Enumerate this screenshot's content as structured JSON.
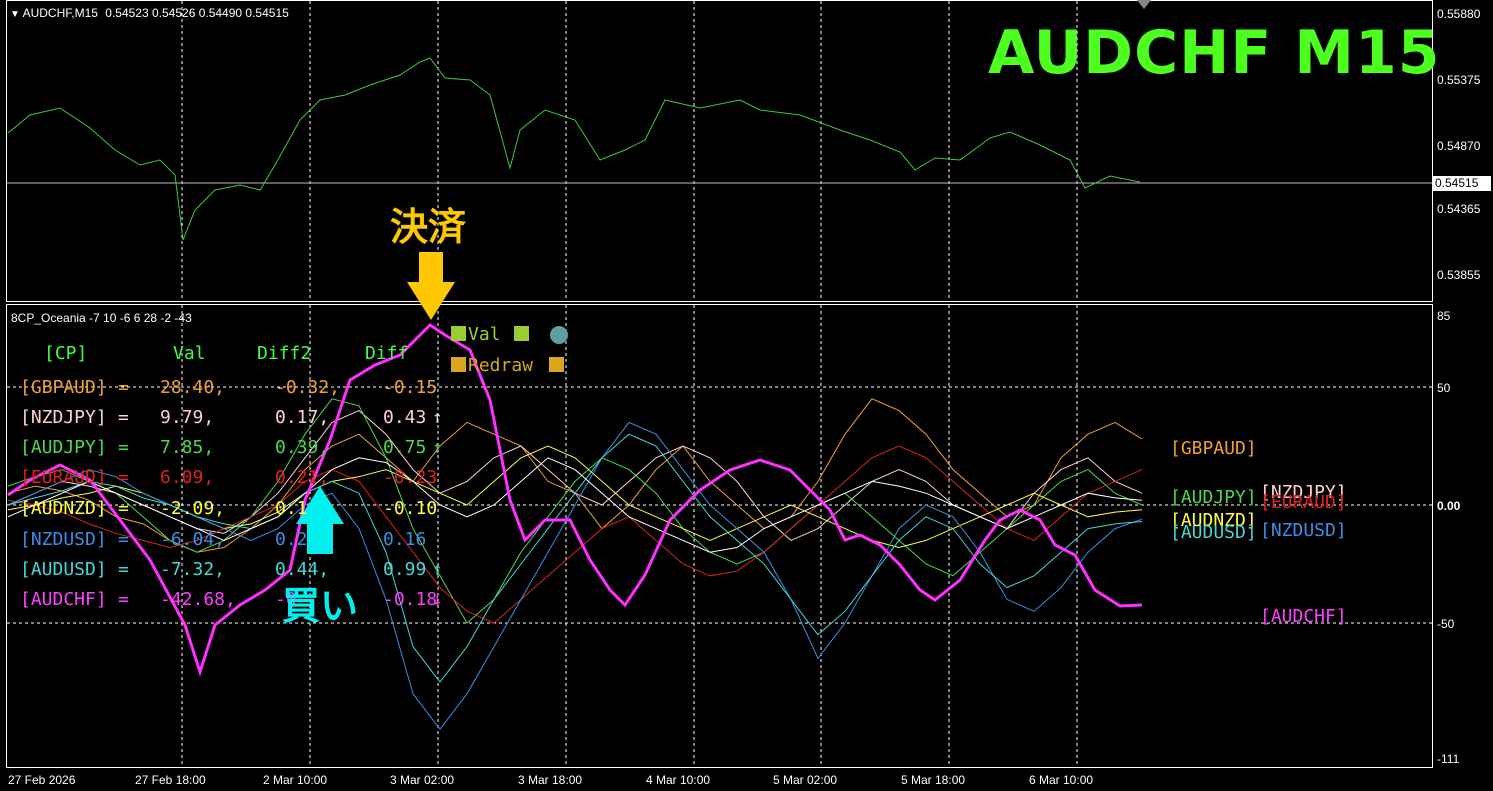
{
  "window": {
    "title": "AUDCHF,M15",
    "ohlc": "0.54523 0.54526 0.54490 0.54515",
    "big_title": "AUDCHF  M15"
  },
  "price_axis": {
    "ticks": [
      "0.55880",
      "0.55375",
      "0.54870",
      "0.54365",
      "0.53855"
    ],
    "current_price": "0.54515"
  },
  "indicator": {
    "name": "8CP_Oceania -7 10 -6 6 28 -2 -43",
    "axis_ticks": [
      "85",
      "50",
      "0.00",
      "-50",
      "-111"
    ],
    "buttons": {
      "val": "Val",
      "redraw": "Redraw"
    },
    "header": {
      "cp": "[CP]",
      "val": "Val",
      "diff2": "Diff2",
      "diff": "Diff"
    },
    "rows": [
      {
        "pair": "[GBPAUD]",
        "val": "28.40,",
        "diff2": "-0.32,",
        "diff": "-0.15",
        "arrow": "",
        "color": "#f0a030"
      },
      {
        "pair": "[NZDJPY]",
        "val": "9.79,",
        "diff2": "0.17,",
        "diff": "0.43",
        "arrow": "↑",
        "color": "#ffd0d0"
      },
      {
        "pair": "[AUDJPY]",
        "val": "7.85,",
        "diff2": "0.39,",
        "diff": "0.75",
        "arrow": "↑",
        "color": "#4cd84c"
      },
      {
        "pair": "[EURAUD]",
        "val": "6.09,",
        "diff2": "0.21,",
        "diff": "-0.23",
        "arrow": "",
        "color": "#e02020"
      },
      {
        "pair": "[AUDNZD]",
        "val": "-2.09,",
        "diff2": "0.1",
        "diff": "-0.10",
        "arrow": "",
        "color": "#ffff40"
      },
      {
        "pair": "[NZDUSD]",
        "val": "-6.04,",
        "diff2": "0.2",
        "diff": "0.16",
        "arrow": "",
        "color": "#3a8ee6"
      },
      {
        "pair": "[AUDUSD]",
        "val": "-7.32,",
        "diff2": "0.44,",
        "diff": "0.99",
        "arrow": "↑",
        "color": "#40d8d8"
      },
      {
        "pair": "[AUDCHF]",
        "val": "-42.68,",
        "diff2": "-0",
        "diff": "-0.18",
        "arrow": "↓",
        "color": "#ff40ff"
      }
    ],
    "right_legend": [
      "[GBPAUD]",
      "[AUDJPY]",
      "[NZDJPY]",
      "[EURAUD]",
      "[AUDNZD]",
      "[AUDUSD]",
      "[NZDUSD]",
      "[AUDCHF]"
    ]
  },
  "annotations": {
    "settle": "決済",
    "buy": "買い"
  },
  "time_axis": [
    "27 Feb 2026",
    "27 Feb 18:00",
    "2 Mar 10:00",
    "3 Mar 02:00",
    "3 Mar 18:00",
    "4 Mar 10:00",
    "5 Mar 02:00",
    "5 Mar 18:00",
    "6 Mar 10:00"
  ],
  "colors": {
    "price_line": "#3ec83e",
    "accent_green": "#4cff1e",
    "settle_arrow": "#ffc800",
    "buy_arrow": "#00f0f0",
    "audchf_line": "#ff30ff",
    "grid": "#ffffff"
  },
  "icons": {
    "collapse": "triangle-down-icon",
    "period_marker": "triangle-marker-icon",
    "settle": "down-arrow-icon",
    "buy": "up-arrow-icon"
  }
}
